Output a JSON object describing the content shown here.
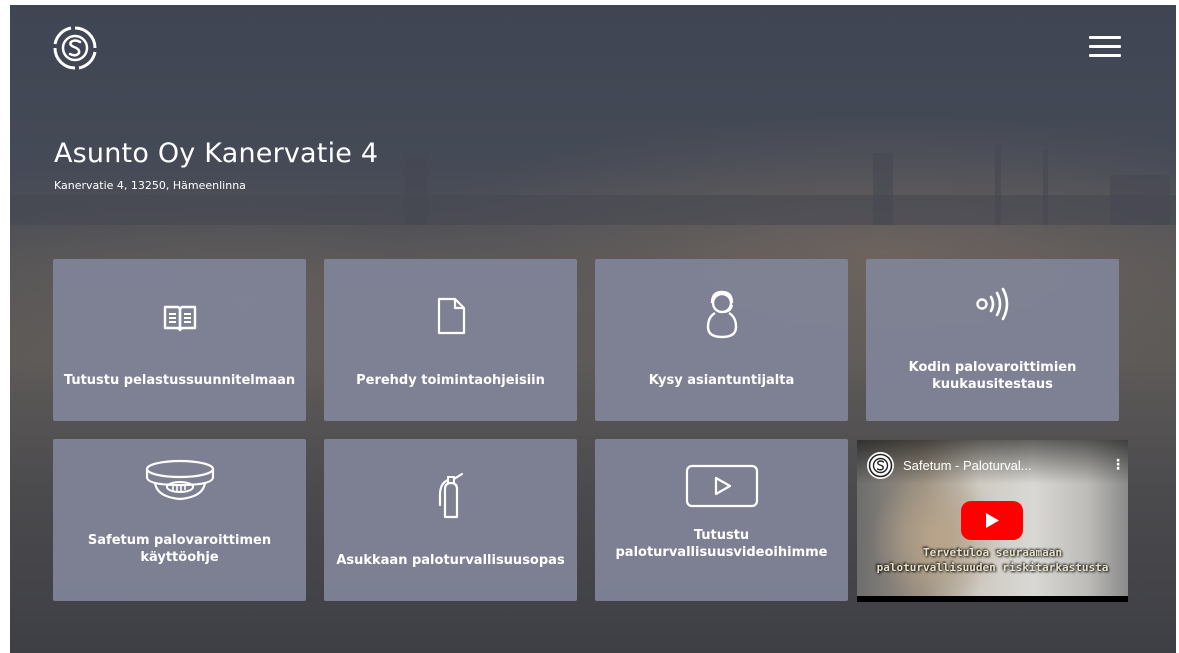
{
  "header": {
    "logo_icon": "safetum-s-logo-icon",
    "menu_icon": "hamburger-menu-icon"
  },
  "property": {
    "name": "Asunto Oy Kanervatie 4",
    "address": "Kanervatie 4, 13250, Hämeenlinna"
  },
  "tiles": [
    {
      "label": "Tutustu pelastussuunnitelmaan",
      "icon": "open-book-icon"
    },
    {
      "label": "Perehdy toimintaohjeisiin",
      "icon": "document-icon"
    },
    {
      "label": "Kysy asiantuntijalta",
      "icon": "person-headset-icon"
    },
    {
      "label_line1": "Kodin palovaroittimien",
      "label_line2": "kuukausitestaus",
      "icon": "signal-waves-icon"
    },
    {
      "label_line1": "Safetum palovaroittimen",
      "label_line2": "käyttöohje",
      "icon": "smoke-detector-icon"
    },
    {
      "label": "Asukkaan paloturvallisuusopas",
      "icon": "fire-extinguisher-icon"
    },
    {
      "label_line1": "Tutustu",
      "label_line2": "paloturvallisuusvideoihimme",
      "icon": "play-button-icon"
    }
  ],
  "video": {
    "title": "Safetum - Paloturval...",
    "more": "⋮",
    "caption_line1": "Tervetuloa seuraamaan",
    "caption_line2": "paloturvallisuuden riskitarkastusta",
    "play_color": "#ff0000"
  },
  "colors": {
    "tile_bg": "#8084a0",
    "text": "#ffffff"
  }
}
